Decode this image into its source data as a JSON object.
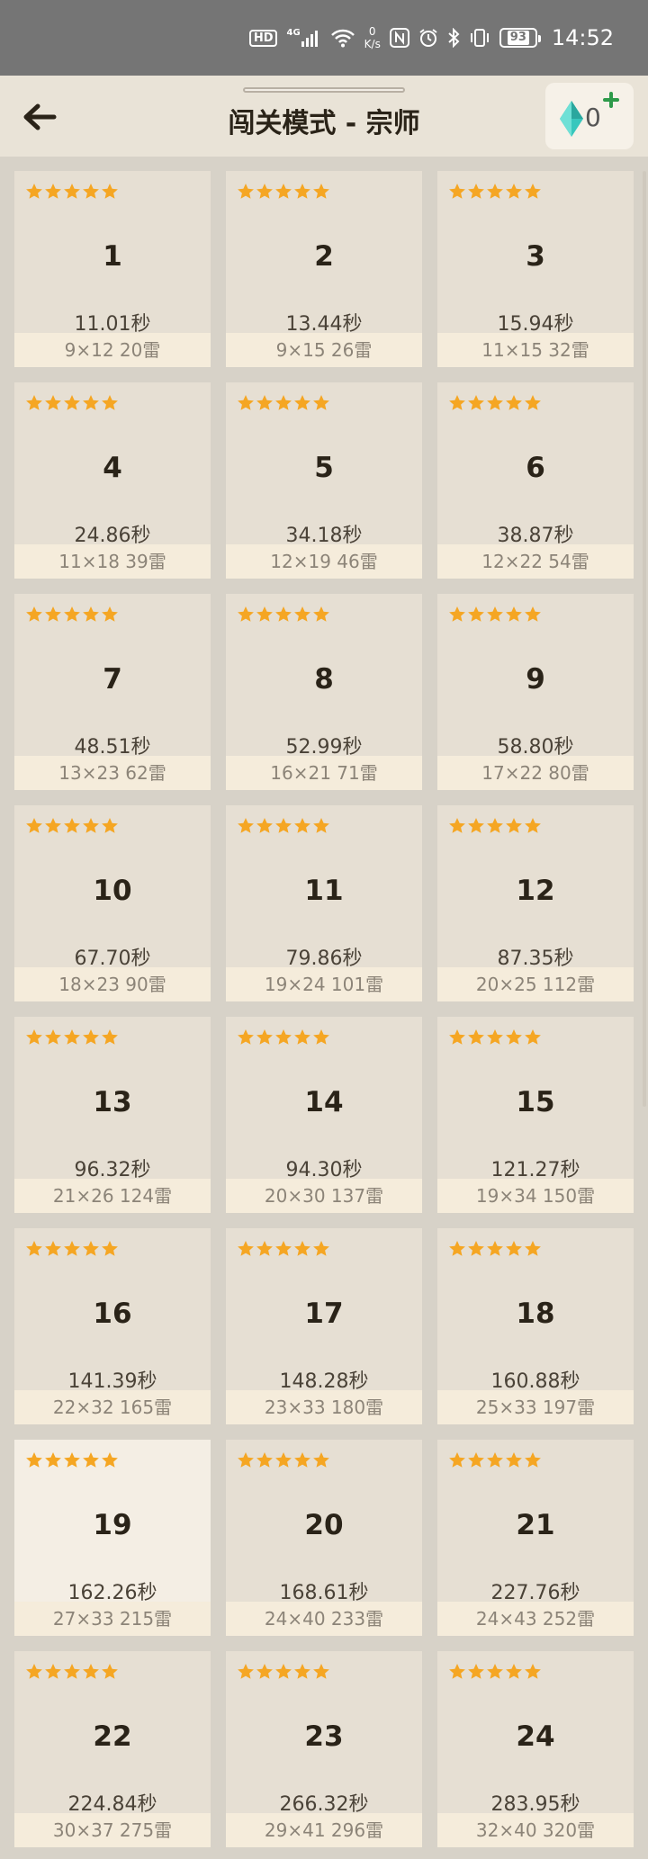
{
  "status_bar": {
    "hd": "HD",
    "signal": "4G",
    "net_speed_value": "0",
    "net_speed_unit": "K/s",
    "battery": "93",
    "time": "14:52"
  },
  "header": {
    "title": "闯关模式 - 宗师",
    "gems": "0"
  },
  "colors": {
    "star": "#f5a623",
    "gem": "#38c7bd",
    "plus": "#2e9a4a",
    "card_bg": "#e6dfd3",
    "card_selected_bg": "#f4eee4",
    "info_bg": "#f5ecdb"
  },
  "icons": {
    "back": "back-arrow-icon",
    "gem": "diamond-icon",
    "plus": "plus-icon",
    "star": "star-icon"
  },
  "levels": [
    {
      "num": "1",
      "time": "11.01秒",
      "info": "9×12  20雷",
      "stars": 5
    },
    {
      "num": "2",
      "time": "13.44秒",
      "info": "9×15  26雷",
      "stars": 5
    },
    {
      "num": "3",
      "time": "15.94秒",
      "info": "11×15  32雷",
      "stars": 5
    },
    {
      "num": "4",
      "time": "24.86秒",
      "info": "11×18  39雷",
      "stars": 5
    },
    {
      "num": "5",
      "time": "34.18秒",
      "info": "12×19  46雷",
      "stars": 5
    },
    {
      "num": "6",
      "time": "38.87秒",
      "info": "12×22  54雷",
      "stars": 5
    },
    {
      "num": "7",
      "time": "48.51秒",
      "info": "13×23  62雷",
      "stars": 5
    },
    {
      "num": "8",
      "time": "52.99秒",
      "info": "16×21  71雷",
      "stars": 5
    },
    {
      "num": "9",
      "time": "58.80秒",
      "info": "17×22  80雷",
      "stars": 5
    },
    {
      "num": "10",
      "time": "67.70秒",
      "info": "18×23  90雷",
      "stars": 5
    },
    {
      "num": "11",
      "time": "79.86秒",
      "info": "19×24  101雷",
      "stars": 5
    },
    {
      "num": "12",
      "time": "87.35秒",
      "info": "20×25  112雷",
      "stars": 5
    },
    {
      "num": "13",
      "time": "96.32秒",
      "info": "21×26  124雷",
      "stars": 5
    },
    {
      "num": "14",
      "time": "94.30秒",
      "info": "20×30  137雷",
      "stars": 5
    },
    {
      "num": "15",
      "time": "121.27秒",
      "info": "19×34  150雷",
      "stars": 5
    },
    {
      "num": "16",
      "time": "141.39秒",
      "info": "22×32  165雷",
      "stars": 5
    },
    {
      "num": "17",
      "time": "148.28秒",
      "info": "23×33  180雷",
      "stars": 5
    },
    {
      "num": "18",
      "time": "160.88秒",
      "info": "25×33  197雷",
      "stars": 5
    },
    {
      "num": "19",
      "time": "162.26秒",
      "info": "27×33  215雷",
      "stars": 5,
      "selected": true
    },
    {
      "num": "20",
      "time": "168.61秒",
      "info": "24×40  233雷",
      "stars": 5
    },
    {
      "num": "21",
      "time": "227.76秒",
      "info": "24×43  252雷",
      "stars": 5
    },
    {
      "num": "22",
      "time": "224.84秒",
      "info": "30×37  275雷",
      "stars": 5
    },
    {
      "num": "23",
      "time": "266.32秒",
      "info": "29×41  296雷",
      "stars": 5
    },
    {
      "num": "24",
      "time": "283.95秒",
      "info": "32×40  320雷",
      "stars": 5
    }
  ]
}
